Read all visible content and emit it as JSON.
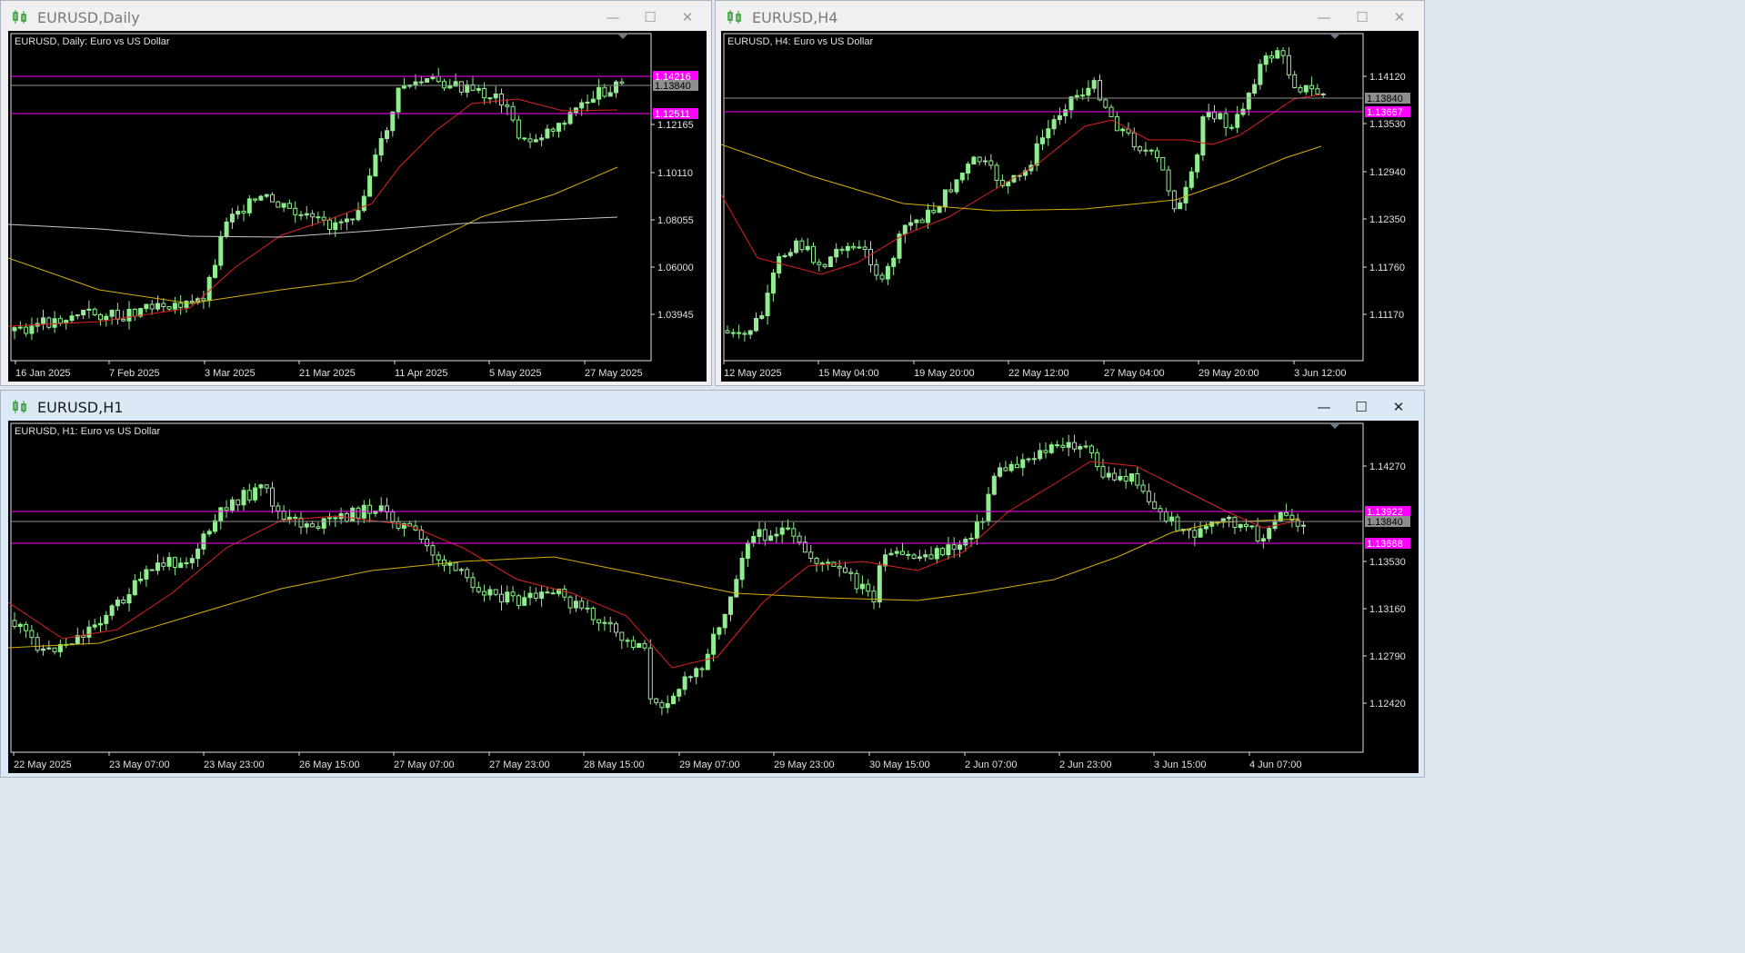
{
  "windows": [
    {
      "title": "EURUSD,Daily",
      "chart_label": "EURUSD, Daily:  Euro vs US Dollar",
      "y_ticks": [
        "1.12165",
        "1.10110",
        "1.08055",
        "1.06000",
        "1.03945"
      ],
      "x_ticks": [
        "16 Jan 2025",
        "7 Feb 2025",
        "3 Mar 2025",
        "21 Mar 2025",
        "11 Apr 2025",
        "5 May 2025",
        "27 May 2025"
      ],
      "price_tags": [
        {
          "text": "1.14216",
          "color": "#ff00ff"
        },
        {
          "text": "1.13840",
          "color": "#8e8e8e"
        },
        {
          "text": "1.12511",
          "color": "#ff00ff"
        }
      ]
    },
    {
      "title": "EURUSD,H4",
      "chart_label": "EURUSD, H4:  Euro vs US Dollar",
      "y_ticks": [
        "1.14120",
        "1.13530",
        "1.12940",
        "1.12350",
        "1.11760",
        "1.11170"
      ],
      "x_ticks": [
        "12 May 2025",
        "15 May 04:00",
        "19 May 20:00",
        "22 May 12:00",
        "27 May 04:00",
        "29 May 20:00",
        "3 Jun 12:00"
      ],
      "price_tags": [
        {
          "text": "1.13840",
          "color": "#8e8e8e"
        },
        {
          "text": "1.13667",
          "color": "#ff00ff"
        }
      ]
    },
    {
      "title": "EURUSD,H1",
      "chart_label": "EURUSD, H1:  Euro vs US Dollar",
      "y_ticks": [
        "1.14270",
        "1.13530",
        "1.13160",
        "1.12790",
        "1.12420"
      ],
      "x_ticks": [
        "22 May 2025",
        "23 May 07:00",
        "23 May 23:00",
        "26 May 15:00",
        "27 May 07:00",
        "27 May 23:00",
        "28 May 15:00",
        "29 May 07:00",
        "29 May 23:00",
        "30 May 15:00",
        "2 Jun 07:00",
        "2 Jun 23:00",
        "3 Jun 15:00",
        "4 Jun 07:00"
      ],
      "price_tags": [
        {
          "text": "1.13922",
          "color": "#ff00ff"
        },
        {
          "text": "1.13840",
          "color": "#8e8e8e"
        },
        {
          "text": "1.13668",
          "color": "#ff00ff"
        }
      ]
    }
  ],
  "window_controls": {
    "minimize": "—",
    "maximize": "☐",
    "close": "✕"
  },
  "colors": {
    "bull_candle": "#90ee90",
    "bear_candle": "#90ee90",
    "ma_fast": "#e02020",
    "ma_slow": "#d4b000",
    "ma_long": "#c8c8c8",
    "level_line": "#ff00ff",
    "bid_line": "#8e8e8e"
  }
}
